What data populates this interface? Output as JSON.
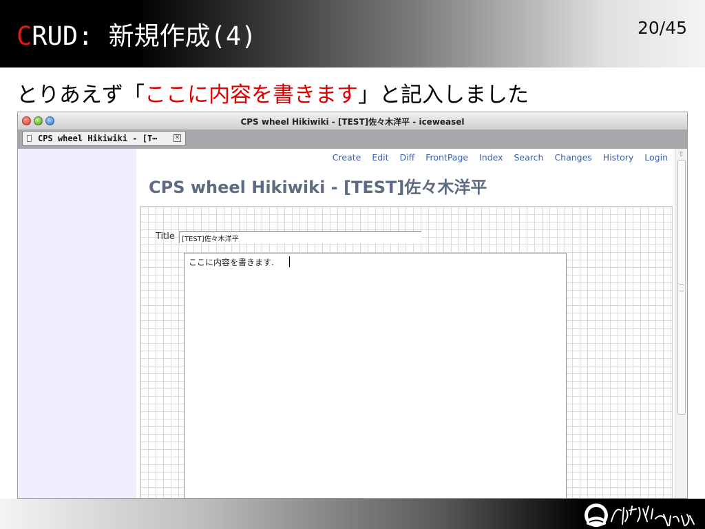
{
  "slide": {
    "title_first_letter": "C",
    "title_rest": "RUD: 新規作成(4)",
    "page_number": "20/45",
    "caption": {
      "before": "とりあえず「",
      "highlight": "ここに内容を書きます",
      "after": "」と記入しました"
    },
    "colors": {
      "accent": "#e00000",
      "header_dark": "#000000"
    }
  },
  "browser": {
    "window_title": "CPS wheel Hikiwiki - [TEST]佐々木洋平 - iceweasel",
    "tab_label": "CPS wheel Hikiwiki - [T⋯",
    "tab_close_icon": "close-box-icon",
    "traffic_lights": [
      "close",
      "minimize",
      "maximize"
    ]
  },
  "wiki": {
    "nav": [
      "Create",
      "Edit",
      "Diff",
      "FrontPage",
      "Index",
      "Search",
      "Changes",
      "History",
      "Login"
    ],
    "page_title": "CPS wheel Hikiwiki - [TEST]佐々木洋平",
    "form": {
      "title_label": "Title",
      "title_value": "[TEST]佐々木洋平",
      "body_value": "ここに内容を書きます."
    },
    "colors": {
      "link": "#3a5ea8",
      "heading": "#5d6c82",
      "sidebar": "#eeeefc"
    }
  }
}
